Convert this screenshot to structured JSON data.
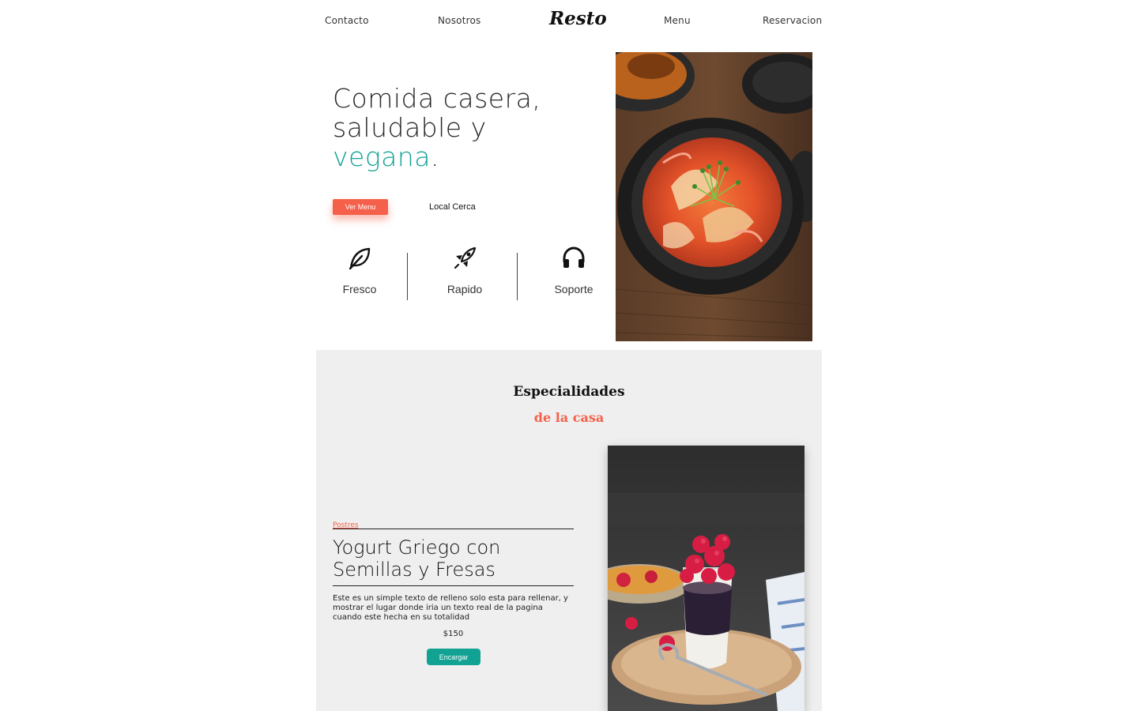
{
  "nav": {
    "links": [
      "Contacto",
      "Nosotros",
      "Menu",
      "Reservacion"
    ],
    "logo": "Resto"
  },
  "hero": {
    "title_line1": "Comida casera,",
    "title_line2": "saludable y",
    "title_accent": "vegana",
    "title_end": ".",
    "primary_button": "Ver Menu",
    "secondary_button": "Local Cerca",
    "features": [
      {
        "label": "Fresco",
        "icon": "leaf-icon"
      },
      {
        "label": "Rapido",
        "icon": "rocket-icon"
      },
      {
        "label": "Soporte",
        "icon": "headphones-icon"
      }
    ],
    "image": "kimchi-bowl-photo"
  },
  "specials": {
    "title": "Especialidades",
    "subtitle": "de la casa",
    "item": {
      "category": "Postres",
      "name_line1": "Yogurt Griego con",
      "name_line2": "Semillas y Fresas",
      "description": "Este es un simple texto de relleno solo esta para rellenar, y mostrar el lugar donde iria un texto real de la pagina cuando este hecha en su totalidad",
      "price": "$150",
      "order_button": "Encargar",
      "image": "yogurt-raspberry-photo"
    }
  },
  "colors": {
    "accent_teal": "#12a294",
    "accent_coral": "#f5604a",
    "section_bg": "#efefef"
  }
}
